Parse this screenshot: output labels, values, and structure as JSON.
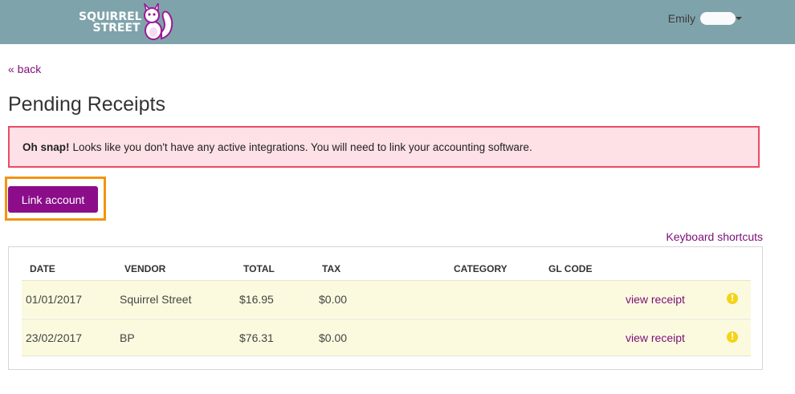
{
  "header": {
    "logo_line1": "SQUIRREL",
    "logo_line2": "STREET",
    "user_name": "Emily"
  },
  "nav": {
    "back_label": "« back"
  },
  "page": {
    "title": "Pending Receipts"
  },
  "alert": {
    "strong": "Oh snap!",
    "message": "Looks like you don't have any active integrations. You will need to link your accounting software."
  },
  "actions": {
    "link_account_label": "Link account",
    "keyboard_shortcuts_label": "Keyboard shortcuts"
  },
  "table": {
    "headers": {
      "date": "DATE",
      "vendor": "VENDOR",
      "total": "TOTAL",
      "tax": "TAX",
      "category": "CATEGORY",
      "gl_code": "GL CODE"
    },
    "rows": [
      {
        "date": "01/01/2017",
        "vendor": "Squirrel Street",
        "total": "$16.95",
        "tax": "$0.00",
        "category": "",
        "gl_code": "",
        "view_label": "view receipt",
        "status_icon": "warning-icon"
      },
      {
        "date": "23/02/2017",
        "vendor": "BP",
        "total": "$76.31",
        "tax": "$0.00",
        "category": "",
        "gl_code": "",
        "view_label": "view receipt",
        "status_icon": "warning-icon"
      }
    ]
  },
  "colors": {
    "header_bg": "#7fa3ab",
    "brand_purple": "#8c0d8a",
    "link_purple": "#7d0d7a",
    "alert_bg": "#fde1e6",
    "alert_border": "#ec4a64",
    "highlight_orange": "#f1950f",
    "row_bg": "#fbfadf",
    "warning_yellow": "#f4d31a"
  }
}
